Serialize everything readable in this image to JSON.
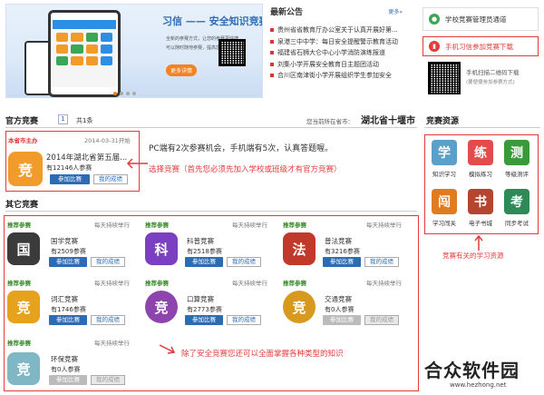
{
  "banner": {
    "title": "习信 —— 安全知识竞赛",
    "lines": [
      "全新的参赛方式，让您的参赛更快捷，",
      "可以随时随地参赛，提高您的学习效率。"
    ],
    "button": "更多详情"
  },
  "notices": {
    "heading": "最新公告",
    "more": "更多»",
    "items": [
      "贵州省省教育厅办公室关于认真开展好第...",
      "泉港三中中学：每日安全提醒警示教育活动",
      "福建省石狮大仑中心小学消防演练报道",
      "刘集小学开展安全教育日主题团活动",
      "合川区南津街小学开展组织学生参加安全"
    ]
  },
  "right_panel": {
    "admin_channel": "学校竞赛管理员通道",
    "mobile_download": "手机习信参加竞赛下载",
    "qr_line1": "手机扫描二维码下载",
    "qr_line2": "(要便捷参加参赛方式)"
  },
  "official": {
    "title": "官方竞赛",
    "page": "1",
    "count": "共1条",
    "location_prefix": "您当前所在省市：",
    "location": "湖北省十堰市",
    "card": {
      "host": "本省市主办",
      "date": "2014-03-31开始",
      "icon_char": "竞",
      "name": "2014年湖北省第五届...",
      "participants": "有12146人参赛",
      "join": "参加比赛",
      "results": "我的成绩"
    },
    "note1": "PC端有2次参赛机会，手机端有5次，认真答题喔。",
    "note2": "选择竞赛（首先您必须先加入学校或班级才有官方竞赛）"
  },
  "other": {
    "title": "其它竞赛",
    "rec_label": "推荐参赛",
    "daily_label": "每天持续举行",
    "join": "参加比赛",
    "results": "我的成绩",
    "cards": [
      {
        "name": "国学竞赛",
        "participants": "有2509参赛",
        "icon_char": "国",
        "icon_color": "#3b3b3b",
        "active": true
      },
      {
        "name": "科普竞赛",
        "participants": "有2518参赛",
        "icon_char": "科",
        "icon_color": "#7b3fc1",
        "active": true
      },
      {
        "name": "普法竞赛",
        "participants": "有3216参赛",
        "icon_char": "法",
        "icon_color": "#c0392b",
        "active": true
      },
      {
        "name": "词汇竞赛",
        "participants": "有1746参赛",
        "icon_char": "竞",
        "icon_color": "#e6a21a",
        "active": true
      },
      {
        "name": "口算竞赛",
        "participants": "有2773参赛",
        "icon_char": "竞",
        "icon_color": "#8e44ad",
        "active": true
      },
      {
        "name": "交通竞赛",
        "participants": "有0人参赛",
        "icon_char": "竞",
        "icon_color": "#d89a1e",
        "active": false
      },
      {
        "name": "环保竞赛",
        "participants": "有0人参赛",
        "icon_char": "竞",
        "icon_color": "#7fb8c4",
        "active": false
      }
    ],
    "note": "除了安全竞赛您还可以全面掌握各种类型的知识"
  },
  "resources": {
    "title": "竞赛资源",
    "tiles": [
      {
        "label": "知识学习",
        "char": "学",
        "color": "#5aa0c8"
      },
      {
        "label": "模拟练习",
        "char": "练",
        "color": "#e24c4c"
      },
      {
        "label": "等级测评",
        "char": "测",
        "color": "#3a9a3a"
      },
      {
        "label": "学习闯关",
        "char": "闯",
        "color": "#e07b1f"
      },
      {
        "label": "电子书城",
        "char": "书",
        "color": "#b5452f"
      },
      {
        "label": "同步考试",
        "char": "考",
        "color": "#2e8b57"
      }
    ],
    "note": "竞赛有关的学习资源"
  },
  "watermark": {
    "text": "合众软件园",
    "url": "www.hezhong.net"
  },
  "colors": {
    "accent_blue": "#2d6cb5",
    "annotation_red": "#e23b3b",
    "rec_green": "#3a8a2a",
    "orange": "#f58220"
  }
}
